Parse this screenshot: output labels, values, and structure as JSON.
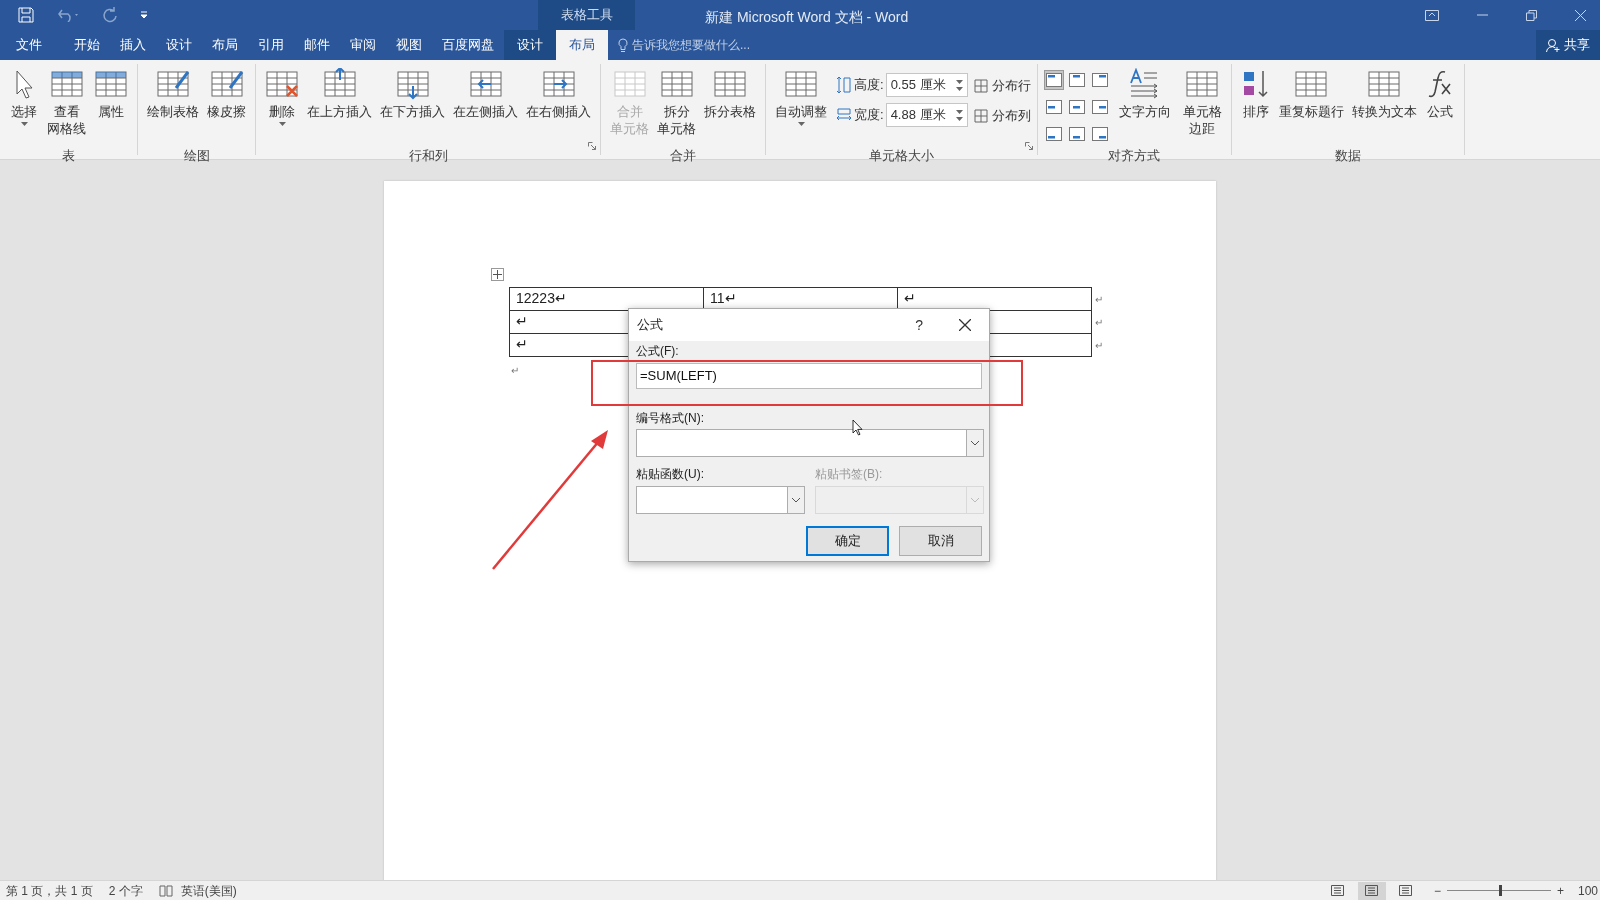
{
  "window_title": "新建 Microsoft Word 文档 - Word",
  "context_label": "表格工具",
  "menu_tabs": [
    {
      "label": "文件",
      "selected": false,
      "kind": "normal"
    },
    {
      "label": "开始",
      "selected": false,
      "kind": "normal"
    },
    {
      "label": "插入",
      "selected": false,
      "kind": "normal"
    },
    {
      "label": "设计",
      "selected": false,
      "kind": "normal"
    },
    {
      "label": "布局",
      "selected": false,
      "kind": "normal"
    },
    {
      "label": "引用",
      "selected": false,
      "kind": "normal"
    },
    {
      "label": "邮件",
      "selected": false,
      "kind": "normal"
    },
    {
      "label": "审阅",
      "selected": false,
      "kind": "normal"
    },
    {
      "label": "视图",
      "selected": false,
      "kind": "normal"
    },
    {
      "label": "百度网盘",
      "selected": false,
      "kind": "normal"
    },
    {
      "label": "设计",
      "selected": false,
      "kind": "contextual"
    },
    {
      "label": "布局",
      "selected": true,
      "kind": "contextual"
    }
  ],
  "tell_me": {
    "placeholder": "告诉我您想要做什么..."
  },
  "share_button": "共享",
  "ribbon_groups": [
    {
      "label": "表",
      "kind": "buttons",
      "buttons": [
        {
          "label": "选择",
          "dropdown": true,
          "disabled": false
        },
        {
          "label": [
            "查看",
            "网格线"
          ],
          "dropdown": false,
          "disabled": false
        },
        {
          "label": "属性",
          "dropdown": false,
          "disabled": false
        }
      ]
    },
    {
      "label": "绘图",
      "kind": "buttons",
      "buttons": [
        {
          "label": "绘制表格",
          "dropdown": false,
          "disabled": false
        },
        {
          "label": "橡皮擦",
          "dropdown": false,
          "disabled": false
        }
      ]
    },
    {
      "label": "行和列",
      "kind": "buttons",
      "launcher": true,
      "buttons": [
        {
          "label": "删除",
          "dropdown": true,
          "disabled": false
        },
        {
          "label": "在上方插入",
          "dropdown": false,
          "disabled": false
        },
        {
          "label": "在下方插入",
          "dropdown": false,
          "disabled": false
        },
        {
          "label": "在左侧插入",
          "dropdown": false,
          "disabled": false
        },
        {
          "label": "在右侧插入",
          "dropdown": false,
          "disabled": false
        }
      ]
    },
    {
      "label": "合并",
      "kind": "buttons",
      "buttons": [
        {
          "label": [
            "合并",
            "单元格"
          ],
          "dropdown": false,
          "disabled": true
        },
        {
          "label": [
            "拆分",
            "单元格"
          ],
          "dropdown": false,
          "disabled": false
        },
        {
          "label": "拆分表格",
          "dropdown": false,
          "disabled": false
        }
      ]
    },
    {
      "label": "单元格大小",
      "kind": "cell_size",
      "launcher": true,
      "buttons": [
        {
          "label": "自动调整",
          "dropdown": true,
          "disabled": false
        }
      ],
      "fields": [
        {
          "label": "高度:",
          "value": "0.55 厘米"
        },
        {
          "label": "宽度:",
          "value": "4.88 厘米"
        }
      ],
      "distribute": [
        "分布行",
        "分布列"
      ]
    },
    {
      "label": "对齐方式",
      "kind": "alignment",
      "align_cells": [
        {
          "selected": true
        },
        {
          "selected": false
        },
        {
          "selected": false
        },
        {
          "selected": false
        },
        {
          "selected": false
        },
        {
          "selected": false
        },
        {
          "selected": false
        },
        {
          "selected": false
        },
        {
          "selected": false
        }
      ],
      "buttons": [
        {
          "label": "文字方向",
          "dropdown": false,
          "disabled": false
        },
        {
          "label": [
            "单元格",
            "边距"
          ],
          "dropdown": false,
          "disabled": false
        }
      ]
    },
    {
      "label": "数据",
      "kind": "buttons",
      "buttons": [
        {
          "label": "排序",
          "dropdown": false,
          "disabled": false
        },
        {
          "label": "重复标题行",
          "dropdown": false,
          "disabled": false
        },
        {
          "label": "转换为文本",
          "dropdown": false,
          "disabled": false
        },
        {
          "label": "公式",
          "dropdown": false,
          "disabled": false
        }
      ]
    }
  ],
  "table": {
    "rows": [
      {
        "cells": [
          "12223↵",
          "11↵",
          "↵"
        ],
        "end": "↵"
      },
      {
        "cells": [
          "↵",
          null,
          null
        ],
        "end": "↵"
      },
      {
        "cells": [
          "↵",
          null,
          null
        ],
        "end": "↵"
      }
    ],
    "after": "↵"
  },
  "dialog": {
    "title": "公式",
    "help": "?",
    "formula": {
      "label": "公式(F):",
      "value": "=SUM(LEFT)"
    },
    "number_format": {
      "label": "编号格式(N):",
      "disabled": false
    },
    "paste_function": {
      "label": "粘贴函数(U):",
      "disabled": false
    },
    "paste_bookmark": {
      "label": "粘贴书签(B):",
      "disabled": true
    },
    "buttons": [
      {
        "label": "确定",
        "default": true
      },
      {
        "label": "取消",
        "default": false
      }
    ]
  },
  "status_bar": {
    "page": "第 1 页，共 1 页",
    "words": "2 个字",
    "language": "英语(美国)",
    "views": [
      {
        "selected": false
      },
      {
        "selected": true
      },
      {
        "selected": false
      }
    ],
    "zoom_out": "−",
    "zoom": {
      "level": 0.5
    },
    "zoom_in": "+",
    "zoom_text": "100"
  }
}
